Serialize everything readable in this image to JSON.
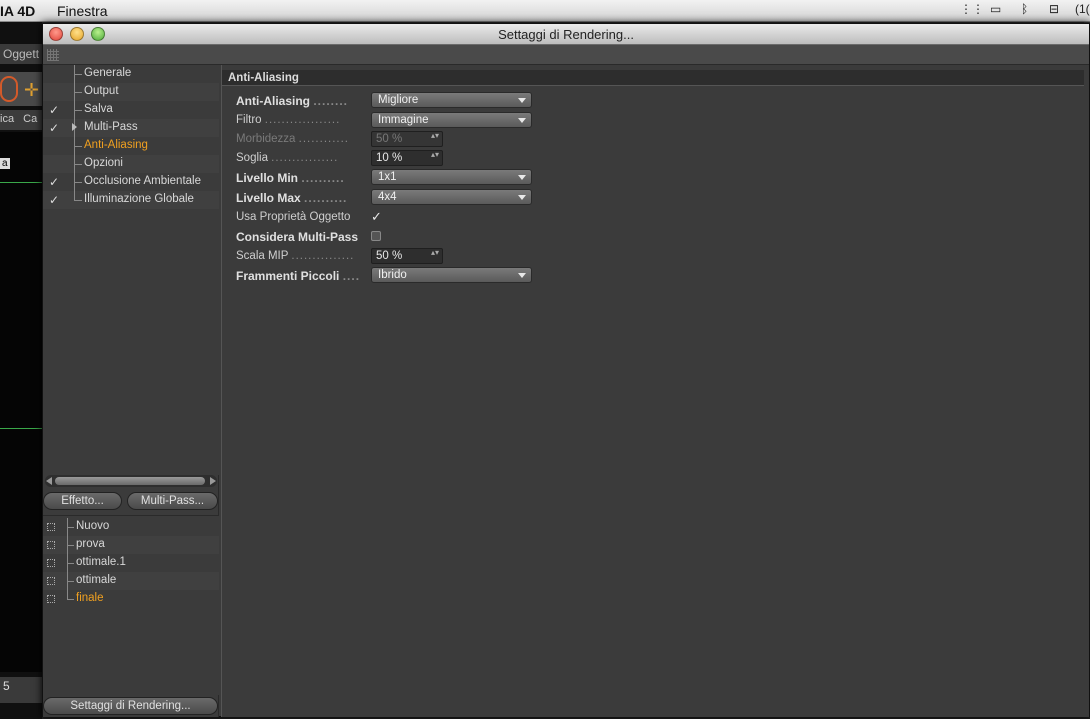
{
  "menubar": {
    "app_name": "IA 4D",
    "menu_finestra": "Finestra",
    "tray_battery": "(1("
  },
  "background_app": {
    "toolbar_label": "Oggett",
    "tab_1": "ica",
    "tab_2": "Ca",
    "viewport_label": "a",
    "ruler_value": "5"
  },
  "window": {
    "title": "Settaggi di Rendering..."
  },
  "tree": {
    "items": [
      {
        "label": "Generale",
        "checked": false,
        "arrow": false
      },
      {
        "label": "Output",
        "checked": false,
        "arrow": false
      },
      {
        "label": "Salva",
        "checked": true,
        "arrow": false
      },
      {
        "label": "Multi-Pass",
        "checked": true,
        "arrow": true
      },
      {
        "label": "Anti-Aliasing",
        "checked": false,
        "arrow": false,
        "selected": true
      },
      {
        "label": "Opzioni",
        "checked": false,
        "arrow": false
      },
      {
        "label": "Occlusione Ambientale",
        "checked": true,
        "arrow": false
      },
      {
        "label": "Illuminazione Globale",
        "checked": true,
        "arrow": false
      }
    ],
    "checkmark": "✓"
  },
  "buttons": {
    "effetto": "Effetto...",
    "multipass": "Multi-Pass...",
    "settaggi": "Settaggi di Rendering..."
  },
  "presets": {
    "items": [
      {
        "label": "Nuovo"
      },
      {
        "label": "prova"
      },
      {
        "label": "ottimale.1"
      },
      {
        "label": "ottimale"
      },
      {
        "label": "finale",
        "selected": true
      }
    ]
  },
  "section": {
    "title": "Anti-Aliasing"
  },
  "properties": {
    "anti_aliasing": {
      "label": "Anti-Aliasing",
      "dots": "........",
      "value": "Migliore"
    },
    "filtro": {
      "label": "Filtro",
      "dots": "..................",
      "value": "Immagine"
    },
    "morbidezza": {
      "label": "Morbidezza",
      "dots": "............",
      "value": "50 %"
    },
    "soglia": {
      "label": "Soglia",
      "dots": "................",
      "value": "10 %"
    },
    "livello_min": {
      "label": "Livello Min",
      "dots": "..........",
      "value": "1x1"
    },
    "livello_max": {
      "label": "Livello Max",
      "dots": "..........",
      "value": "4x4"
    },
    "usa_proprieta": {
      "label": "Usa Proprietà Oggetto",
      "checked": "✓"
    },
    "considera_multipass": {
      "label": "Considera Multi-Pass",
      "checked": ""
    },
    "scala_mip": {
      "label": "Scala MIP",
      "dots": "...............",
      "value": "50 %"
    },
    "frammenti": {
      "label": "Frammenti Piccoli",
      "dots": "....",
      "value": "Ibrido"
    }
  },
  "spinner_glyph": "▴▾",
  "colors": {
    "accent_selected": "#f0a020",
    "panel_bg": "#3b3b3b",
    "section_bg": "#2d2d2d"
  }
}
